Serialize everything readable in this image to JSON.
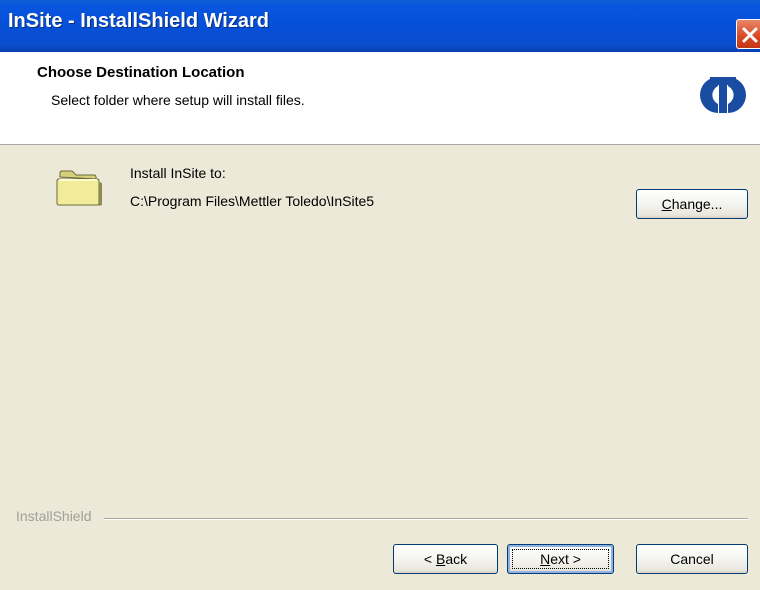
{
  "window": {
    "title": "InSite - InstallShield Wizard"
  },
  "header": {
    "title": "Choose Destination Location",
    "subtitle": "Select folder where setup will install files.",
    "logo_icon": "mettler-toledo-logo-icon"
  },
  "content": {
    "install_label": "Install InSite to:",
    "install_path": "C:\\Program Files\\Mettler Toledo\\InSite5",
    "folder_icon": "folder-icon",
    "change_button": {
      "accel": "C",
      "rest": "hange..."
    }
  },
  "footer": {
    "brand": "InstallShield",
    "back_button": {
      "prefix": "< ",
      "accel": "B",
      "rest": "ack"
    },
    "next_button": {
      "accel": "N",
      "rest": "ext >"
    },
    "cancel_button": "Cancel"
  },
  "colors": {
    "titlebar": "#0855dd",
    "close": "#d9461f",
    "dialog_bg": "#ece9d8",
    "logo": "#1a4da1"
  }
}
